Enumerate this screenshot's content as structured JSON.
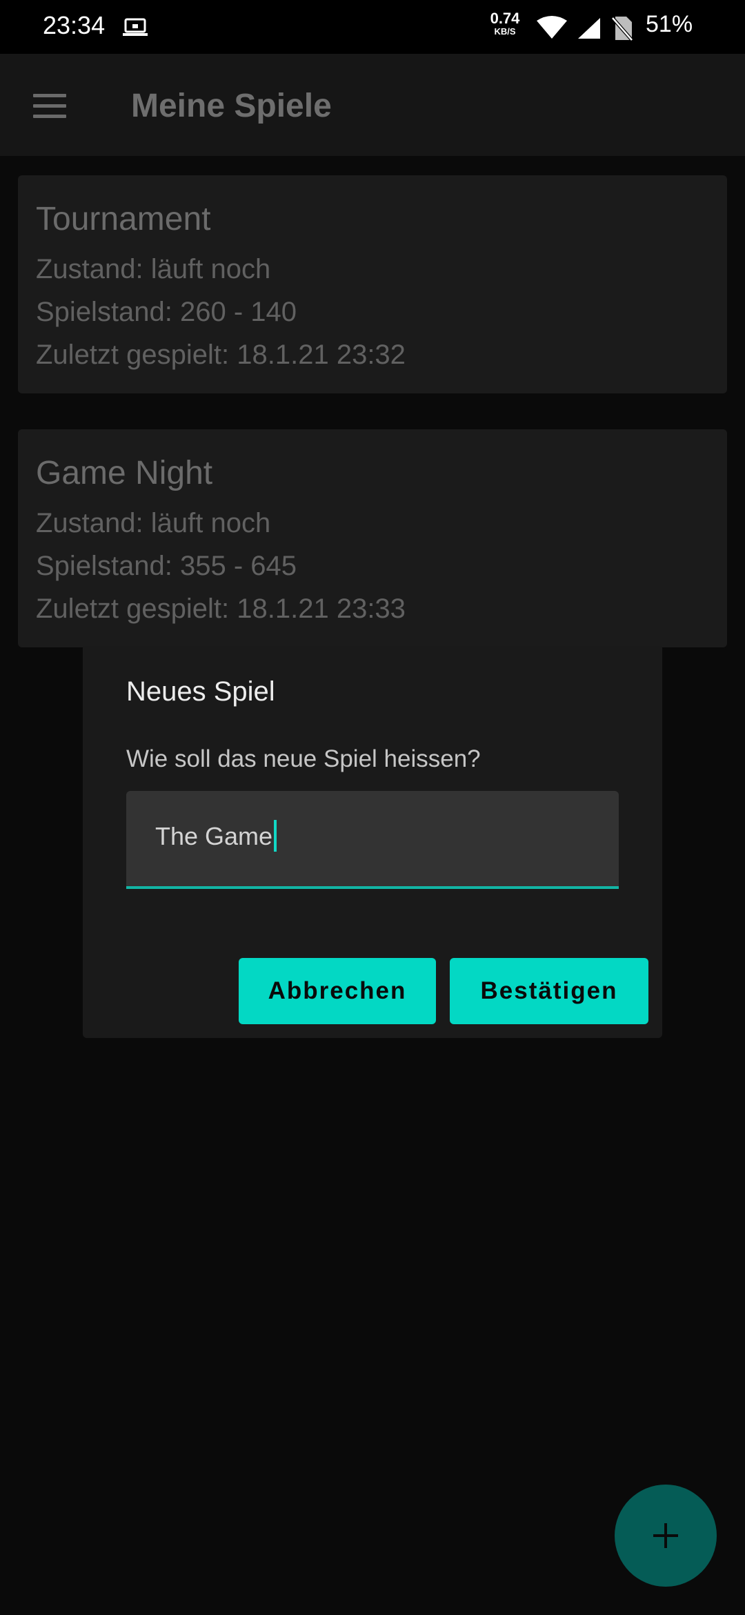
{
  "status_bar": {
    "time": "23:34",
    "net_speed": "0.74",
    "net_speed_unit": "KB/S",
    "battery": "51%",
    "icons": [
      "laptop-icon",
      "wifi-icon",
      "cell-signal-icon",
      "no-sim-icon"
    ]
  },
  "app_bar": {
    "title": "Meine Spiele",
    "menu_icon": "menu-icon"
  },
  "games": [
    {
      "title": "Tournament",
      "state": "Zustand: läuft noch",
      "score": "Spielstand: 260 - 140",
      "last_played": "Zuletzt gespielt: 18.1.21 23:32"
    },
    {
      "title": "Game Night",
      "state": "Zustand: läuft noch",
      "score": "Spielstand: 355 - 645",
      "last_played": "Zuletzt gespielt: 18.1.21 23:33"
    }
  ],
  "dialog": {
    "title": "Neues Spiel",
    "message": "Wie soll das neue Spiel heissen?",
    "input_value": "The Game",
    "cancel_label": "Abbrechen",
    "confirm_label": "Bestätigen"
  },
  "fab": {
    "icon": "plus-icon"
  },
  "colors": {
    "accent": "#03d8c4",
    "fab": "#055c56",
    "background": "#0a0a0a",
    "card": "#1b1b1b",
    "dialog": "#1a1a1a"
  }
}
